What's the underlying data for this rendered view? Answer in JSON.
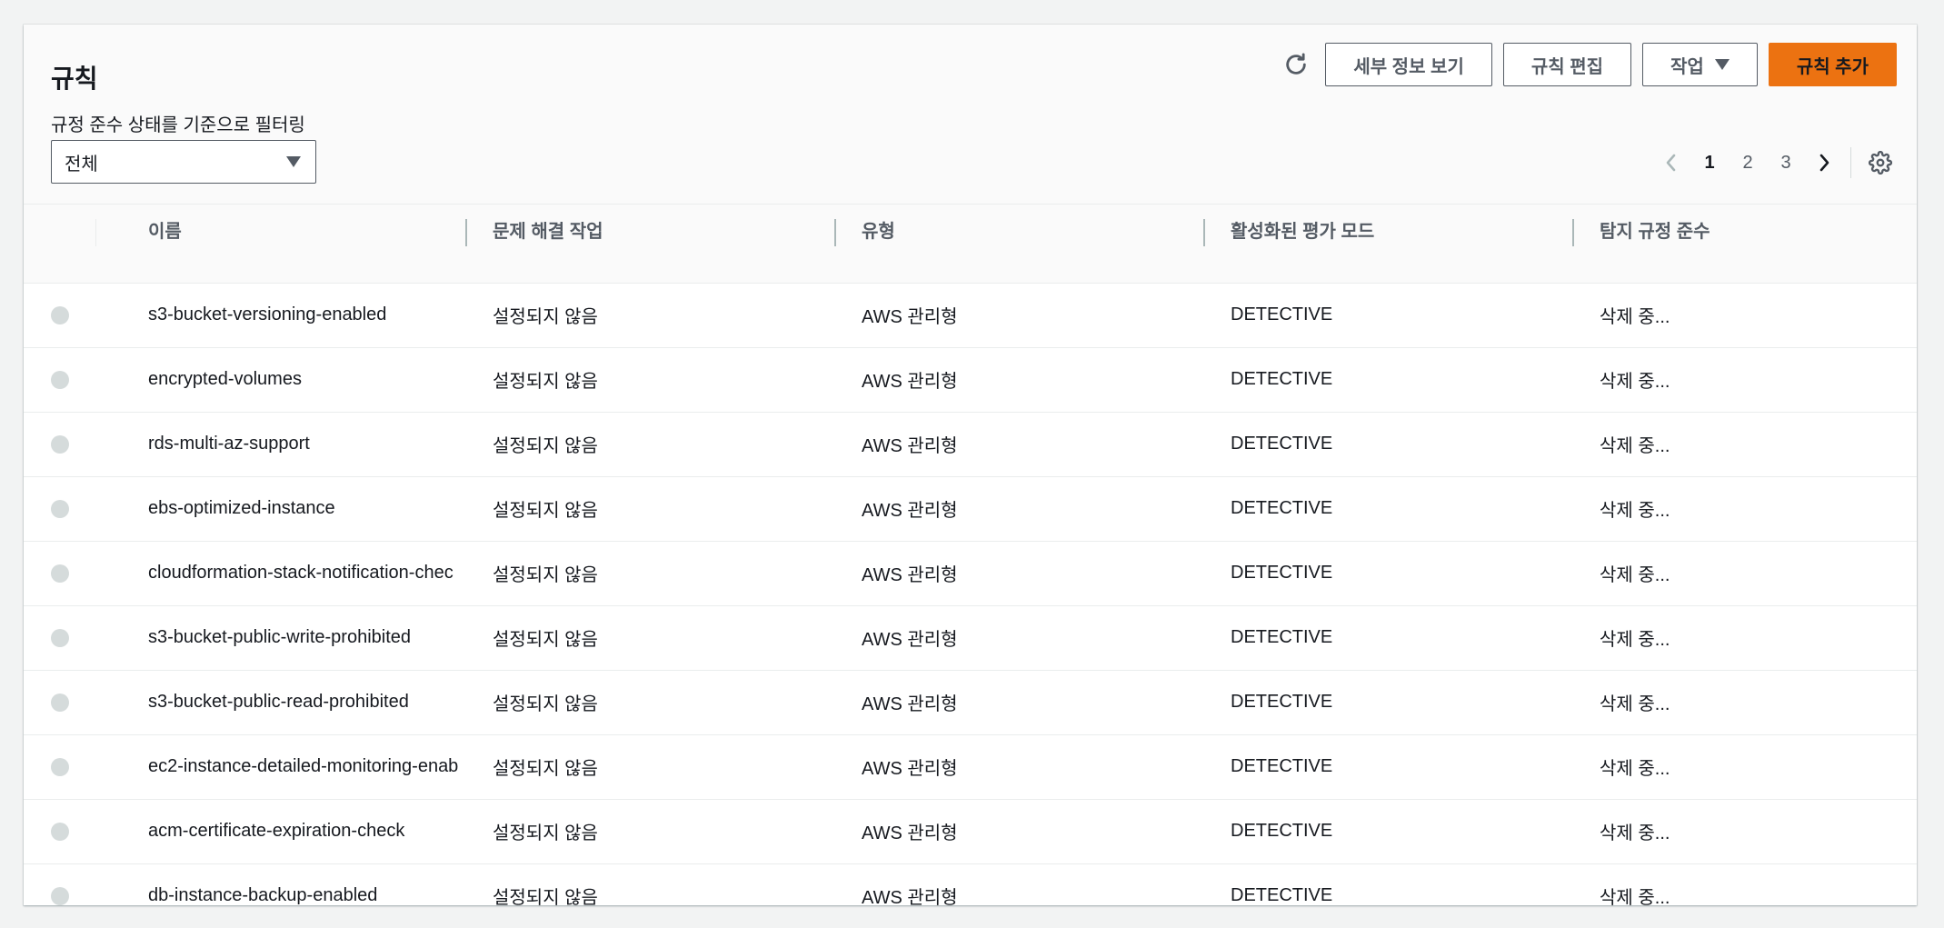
{
  "header": {
    "title": "규칙",
    "filter_label": "규정 준수 상태를 기준으로 필터링",
    "filter_value": "전체"
  },
  "toolbar": {
    "refresh_icon": "refresh-icon",
    "details_label": "세부 정보 보기",
    "edit_label": "규칙 편집",
    "actions_label": "작업",
    "add_label": "규칙 추가",
    "accent_color": "#ec7211"
  },
  "pagination": {
    "pages": [
      "1",
      "2",
      "3"
    ],
    "current": "1"
  },
  "table": {
    "columns": [
      "이름",
      "문제 해결 작업",
      "유형",
      "활성화된 평가 모드",
      "탐지 규정 준수"
    ],
    "rows": [
      {
        "name": "s3-bucket-versioning-enabled",
        "remediation": "설정되지 않음",
        "type": "AWS 관리형",
        "mode": "DETECTIVE",
        "compliance": "삭제 중..."
      },
      {
        "name": "encrypted-volumes",
        "remediation": "설정되지 않음",
        "type": "AWS 관리형",
        "mode": "DETECTIVE",
        "compliance": "삭제 중..."
      },
      {
        "name": "rds-multi-az-support",
        "remediation": "설정되지 않음",
        "type": "AWS 관리형",
        "mode": "DETECTIVE",
        "compliance": "삭제 중..."
      },
      {
        "name": "ebs-optimized-instance",
        "remediation": "설정되지 않음",
        "type": "AWS 관리형",
        "mode": "DETECTIVE",
        "compliance": "삭제 중..."
      },
      {
        "name": "cloudformation-stack-notification-chec",
        "remediation": "설정되지 않음",
        "type": "AWS 관리형",
        "mode": "DETECTIVE",
        "compliance": "삭제 중..."
      },
      {
        "name": "s3-bucket-public-write-prohibited",
        "remediation": "설정되지 않음",
        "type": "AWS 관리형",
        "mode": "DETECTIVE",
        "compliance": "삭제 중..."
      },
      {
        "name": "s3-bucket-public-read-prohibited",
        "remediation": "설정되지 않음",
        "type": "AWS 관리형",
        "mode": "DETECTIVE",
        "compliance": "삭제 중..."
      },
      {
        "name": "ec2-instance-detailed-monitoring-enab",
        "remediation": "설정되지 않음",
        "type": "AWS 관리형",
        "mode": "DETECTIVE",
        "compliance": "삭제 중..."
      },
      {
        "name": "acm-certificate-expiration-check",
        "remediation": "설정되지 않음",
        "type": "AWS 관리형",
        "mode": "DETECTIVE",
        "compliance": "삭제 중..."
      },
      {
        "name": "db-instance-backup-enabled",
        "remediation": "설정되지 않음",
        "type": "AWS 관리형",
        "mode": "DETECTIVE",
        "compliance": "삭제 중..."
      }
    ]
  }
}
